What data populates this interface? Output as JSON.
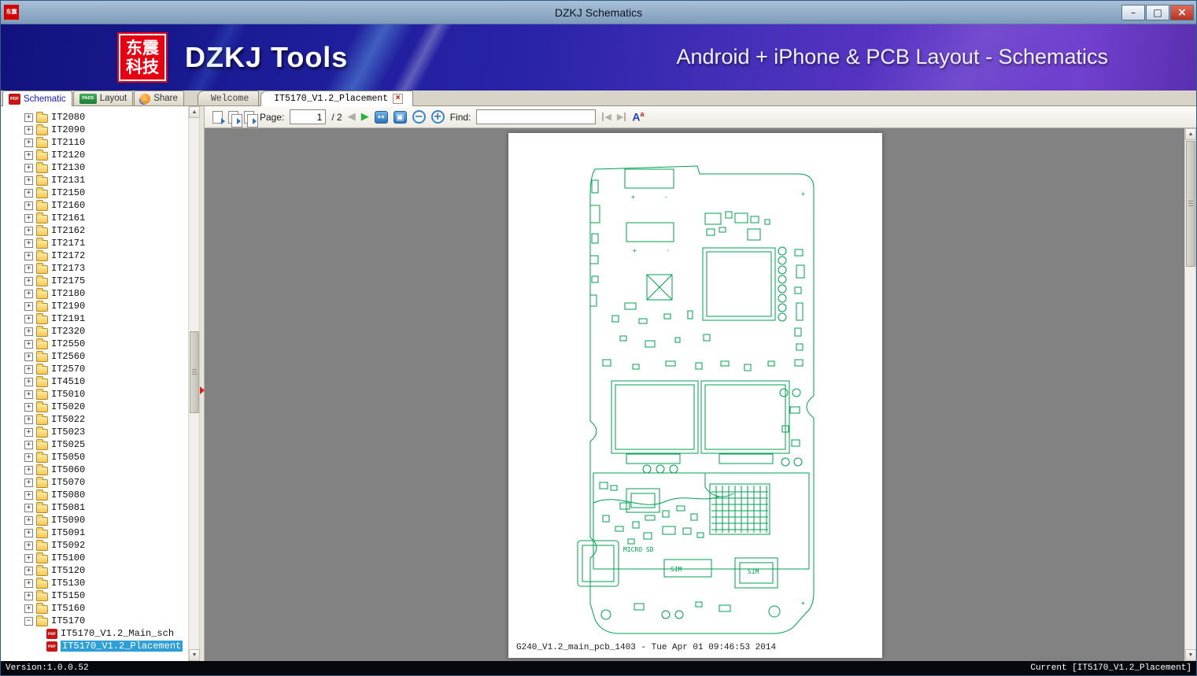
{
  "window": {
    "title": "DZKJ Schematics"
  },
  "banner": {
    "logo_line1": "东震",
    "logo_line2": "科技",
    "title": "DZKJ Tools",
    "subtitle": "Android + iPhone & PCB Layout - Schematics"
  },
  "mode_tabs": [
    {
      "label": "Schematic",
      "active": true
    },
    {
      "label": "Layout",
      "active": false
    },
    {
      "label": "Share",
      "active": false
    }
  ],
  "doc_tabs": [
    {
      "label": "Welcome",
      "active": false
    },
    {
      "label": "IT5170_V1.2_Placement",
      "active": true
    }
  ],
  "toolbar": {
    "page_label": "Page:",
    "page_current": "1",
    "page_total": "/ 2",
    "find_label": "Find:",
    "find_value": ""
  },
  "tree": {
    "folders": [
      "IT2080",
      "IT2090",
      "IT2110",
      "IT2120",
      "IT2130",
      "IT2131",
      "IT2150",
      "IT2160",
      "IT2161",
      "IT2162",
      "IT2171",
      "IT2172",
      "IT2173",
      "IT2175",
      "IT2180",
      "IT2190",
      "IT2191",
      "IT2320",
      "IT2550",
      "IT2560",
      "IT2570",
      "IT4510",
      "IT5010",
      "IT5020",
      "IT5022",
      "IT5023",
      "IT5025",
      "IT5050",
      "IT5060",
      "IT5070",
      "IT5080",
      "IT5081",
      "IT5090",
      "IT5091",
      "IT5092",
      "IT5100",
      "IT5120",
      "IT5130",
      "IT5150",
      "IT5160"
    ],
    "expanded": {
      "label": "IT5170",
      "children": [
        {
          "label": "IT5170_V1.2_Main_sch",
          "selected": false
        },
        {
          "label": "IT5170_V1.2_Placement",
          "selected": true
        }
      ]
    }
  },
  "document": {
    "caption": "G240_V1.2_main_pcb_1403 - Tue Apr 01 09:46:53 2014",
    "labels": {
      "micro_sd": "MICRO SD",
      "sim": "SIM",
      "sim2": "SIM"
    },
    "signs": {
      "plus": "+",
      "minus": "-"
    }
  },
  "status": {
    "left": "Version:1.0.0.52",
    "right": "Current [IT5170_V1.2_Placement]"
  },
  "icons": {
    "minimize": "–",
    "maximize": "□",
    "close": "×",
    "close_tab": "×",
    "pdf": "PDF",
    "pads": "PADS",
    "share_arrow": "→",
    "prev_page": "◀",
    "next_page": "▶",
    "fit_width": "↔",
    "fit_page": "▣",
    "zoom_out": "−",
    "zoom_in": "+",
    "find_prev": "◀",
    "find_next": "▶",
    "match_case_large": "A",
    "match_case_small": "a",
    "scroll_up": "▲",
    "scroll_down": "▼",
    "expand": "+",
    "collapse": "−"
  },
  "colors": {
    "pcb_green": "#00a04f",
    "logo_red": "#e60012",
    "selection_blue": "#2f9fd8",
    "banner_blue": "#2020a0",
    "banner_purple": "#6d3acc"
  }
}
